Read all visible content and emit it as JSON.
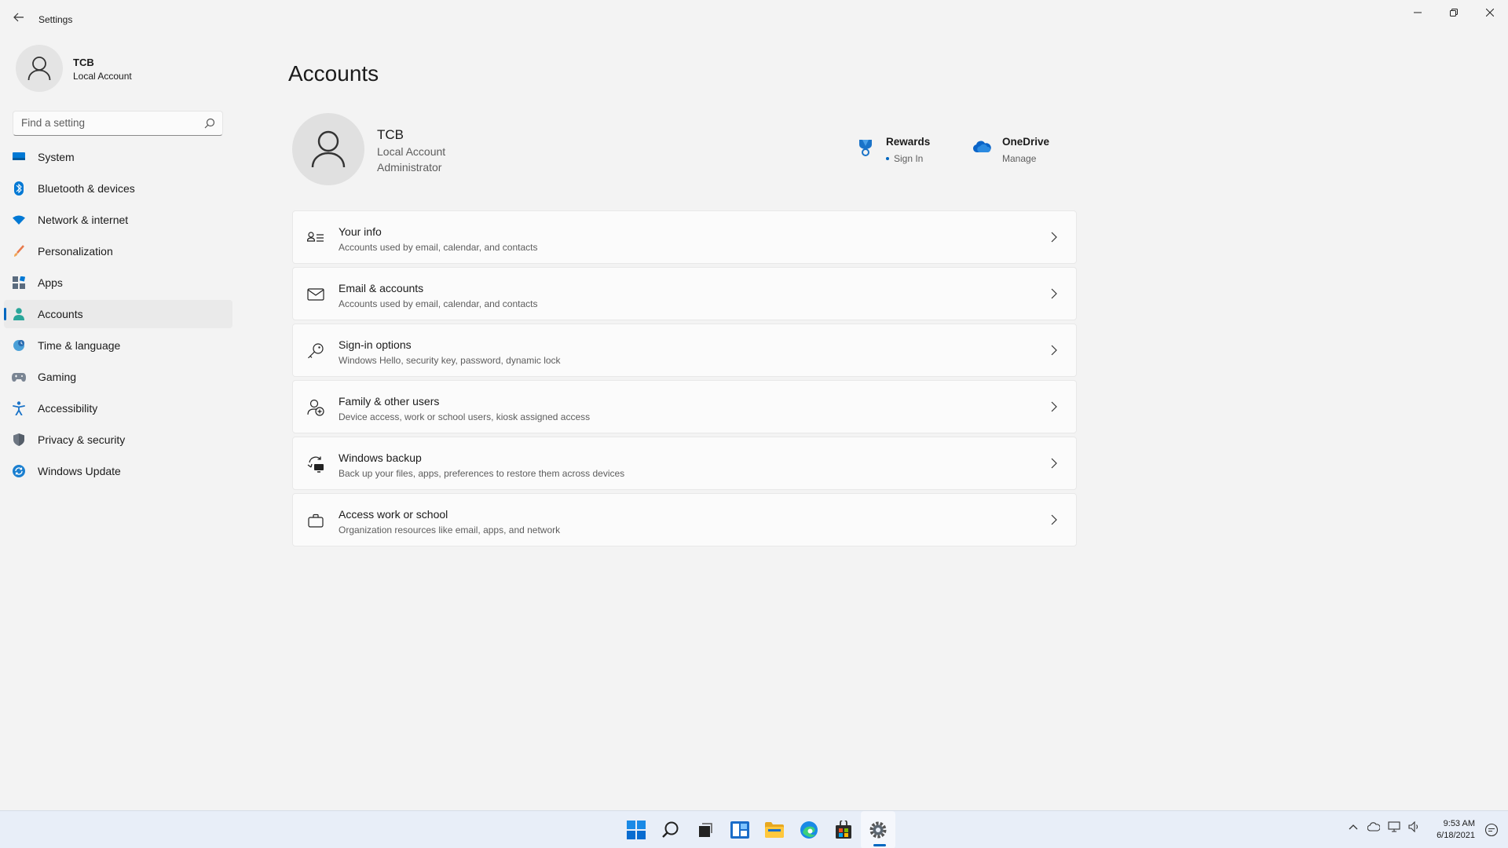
{
  "window": {
    "title": "Settings",
    "back_icon": "arrow-left-icon",
    "controls": [
      "minimize-icon",
      "restore-icon",
      "close-icon"
    ]
  },
  "sidebar": {
    "profile": {
      "name": "TCB",
      "type": "Local Account",
      "avatar_icon": "user-icon"
    },
    "search": {
      "placeholder": "Find a setting",
      "value": "",
      "icon": "search-icon"
    },
    "items": [
      {
        "label": "System",
        "icon": "monitor-icon",
        "active": false
      },
      {
        "label": "Bluetooth & devices",
        "icon": "bluetooth-icon",
        "active": false
      },
      {
        "label": "Network & internet",
        "icon": "wifi-icon",
        "active": false
      },
      {
        "label": "Personalization",
        "icon": "brush-icon",
        "active": false
      },
      {
        "label": "Apps",
        "icon": "apps-icon",
        "active": false
      },
      {
        "label": "Accounts",
        "icon": "person-icon",
        "active": true
      },
      {
        "label": "Time & language",
        "icon": "globe-clock-icon",
        "active": false
      },
      {
        "label": "Gaming",
        "icon": "gamepad-icon",
        "active": false
      },
      {
        "label": "Accessibility",
        "icon": "accessibility-icon",
        "active": false
      },
      {
        "label": "Privacy & security",
        "icon": "shield-icon",
        "active": false
      },
      {
        "label": "Windows Update",
        "icon": "update-icon",
        "active": false
      }
    ]
  },
  "main": {
    "title": "Accounts",
    "account": {
      "name": "TCB",
      "type": "Local Account",
      "role": "Administrator"
    },
    "services": [
      {
        "title": "Rewards",
        "subtitle": "Sign In",
        "icon": "rewards-trophy-icon"
      },
      {
        "title": "OneDrive",
        "subtitle": "Manage",
        "icon": "onedrive-cloud-icon"
      }
    ],
    "cards": [
      {
        "title": "Your info",
        "description": "Accounts used by email, calendar, and contacts",
        "icon": "contact-card-icon"
      },
      {
        "title": "Email & accounts",
        "description": "Accounts used by email, calendar, and contacts",
        "icon": "mail-icon"
      },
      {
        "title": "Sign-in options",
        "description": "Windows Hello, security key, password, dynamic lock",
        "icon": "key-icon"
      },
      {
        "title": "Family & other users",
        "description": "Device access, work or school users, kiosk assigned access",
        "icon": "add-person-icon"
      },
      {
        "title": "Windows backup",
        "description": "Back up your files, apps, preferences to restore them across devices",
        "icon": "backup-icon"
      },
      {
        "title": "Access work or school",
        "description": "Organization resources like email, apps, and network",
        "icon": "briefcase-icon"
      }
    ]
  },
  "taskbar": {
    "apps": [
      {
        "name": "start",
        "icon": "windows-logo-icon"
      },
      {
        "name": "search",
        "icon": "search-icon"
      },
      {
        "name": "task-view",
        "icon": "task-view-icon"
      },
      {
        "name": "widgets",
        "icon": "widgets-icon"
      },
      {
        "name": "file-explorer",
        "icon": "folder-icon"
      },
      {
        "name": "edge",
        "icon": "edge-icon"
      },
      {
        "name": "store",
        "icon": "store-icon"
      },
      {
        "name": "settings",
        "icon": "gear-icon",
        "active": true
      }
    ],
    "clock": {
      "time": "9:53 AM",
      "date": "6/18/2021"
    },
    "accent": "#0067c0"
  }
}
